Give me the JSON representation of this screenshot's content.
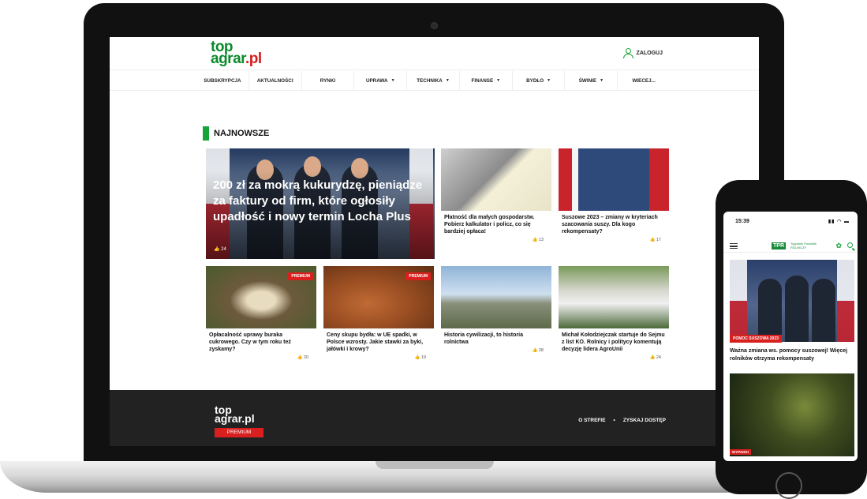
{
  "site": {
    "logo_top": "top",
    "logo_main": "agrar",
    "logo_tld": ".pl",
    "login_label": "ZALOGUJ"
  },
  "nav": {
    "items": [
      {
        "label": "SUBSKRYPCJA",
        "dropdown": false
      },
      {
        "label": "AKTUALNOŚCI",
        "dropdown": false
      },
      {
        "label": "RYNKI",
        "dropdown": false
      },
      {
        "label": "UPRAWA",
        "dropdown": true
      },
      {
        "label": "TECHNIKA",
        "dropdown": true
      },
      {
        "label": "FINANSE",
        "dropdown": true
      },
      {
        "label": "BYDŁO",
        "dropdown": true
      },
      {
        "label": "ŚWINIE",
        "dropdown": true
      },
      {
        "label": "WIECEJ...",
        "dropdown": false
      }
    ]
  },
  "section": {
    "title": "NAJNOWSZE"
  },
  "hero": {
    "title": "200 zł za mokrą kukurydzę, pieniądze za faktury od firm, które ogłosiły upadłość i nowy termin Locha Plus",
    "likes": "24"
  },
  "cards": [
    {
      "title": "Płatność dla małych gospodarstw. Pobierz kalkulator i policz, co się bardziej opłaca!",
      "likes": "13",
      "premium": false
    },
    {
      "title": "Suszowe 2023 – zmiany w kryteriach szacowania suszy. Dla kogo rekompensaty?",
      "likes": "17",
      "premium": false
    },
    {
      "title": "Opłacalność uprawy buraka cukrowego. Czy w tym roku też zyskamy?",
      "likes": "20",
      "premium": true
    },
    {
      "title": "Ceny skupu bydła: w UE spadki, w Polsce wzrosty. Jakie stawki za byki, jałówki i krowy?",
      "likes": "19",
      "premium": true
    },
    {
      "title": "Historia cywilizacji, to historia rolnictwa",
      "likes": "28",
      "premium": false
    },
    {
      "title": "Michał Kołodziejczak startuje do Sejmu z list KO. Rolnicy i politycy komentują decyzję lidera AgroUnii",
      "likes": "24",
      "premium": false
    }
  ],
  "premium_label": "PREMIUM",
  "footer": {
    "logo_top": "top",
    "logo_main": "agrar.pl",
    "premium": "PREMIUM",
    "link1": "O STREFIE",
    "separator": "•",
    "link2": "ZYSKAJ DOSTĘP"
  },
  "phone": {
    "time": "15:39",
    "status_icons": "▮▮ ◠ ▬",
    "brand": "TPR",
    "brand_sub_1": "Tygodnik Poradnik",
    "brand_sub_2": "ROLNICZY",
    "tag1": "POMOC SUSZOWA 2023",
    "title1": "Ważna zmiana ws. pomocy suszowej! Więcej rolników otrzyma rekompensaty",
    "tag2": "WYPADKI"
  },
  "colors": {
    "brand_green": "#0b8a2b",
    "accent_red": "#d9201f",
    "footer_bg": "#222222"
  }
}
